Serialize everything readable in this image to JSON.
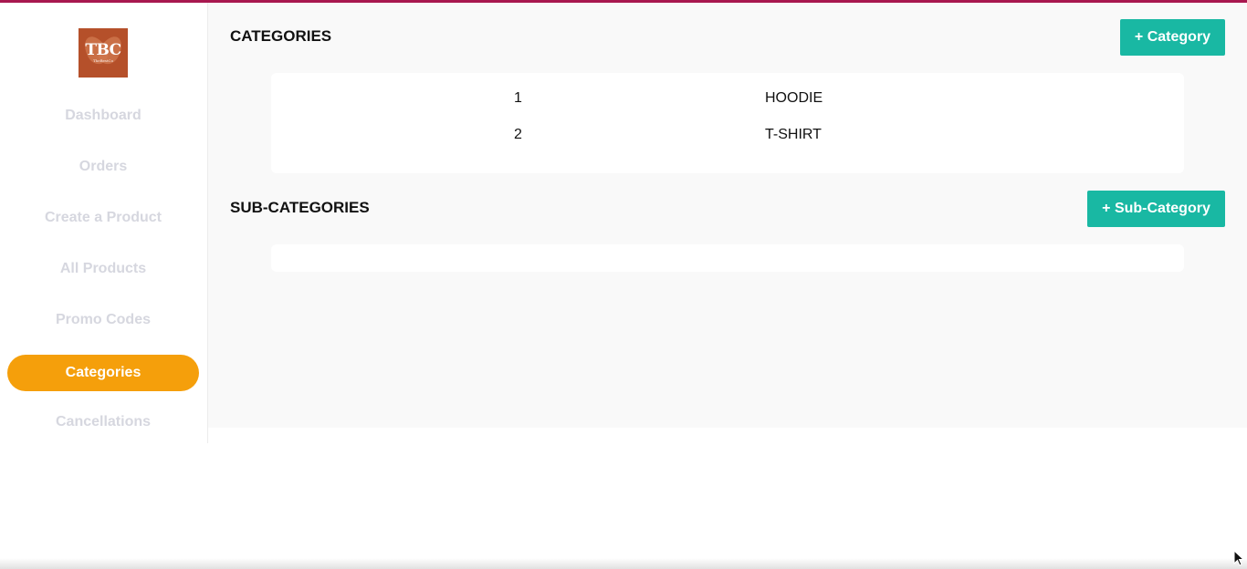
{
  "logo": {
    "text": "TBC",
    "subtext": "TheBestCo"
  },
  "sidebar": {
    "items": [
      {
        "label": "Dashboard",
        "active": false
      },
      {
        "label": "Orders",
        "active": false
      },
      {
        "label": "Create a Product",
        "active": false
      },
      {
        "label": "All Products",
        "active": false
      },
      {
        "label": "Promo Codes",
        "active": false
      },
      {
        "label": "Categories",
        "active": true
      },
      {
        "label": "Cancellations",
        "active": false
      }
    ]
  },
  "categories": {
    "title": "CATEGORIES",
    "add_label": "+ Category",
    "rows": [
      {
        "id": "1",
        "name": "HOODIE"
      },
      {
        "id": "2",
        "name": "T-SHIRT"
      }
    ]
  },
  "subcategories": {
    "title": "SUB-CATEGORIES",
    "add_label": "+ Sub-Category",
    "rows": []
  },
  "colors": {
    "accent_active": "#f59f0b",
    "button": "#19b8a3",
    "topbar": "#a8184f",
    "nav_inactive": "#d6d7df"
  }
}
